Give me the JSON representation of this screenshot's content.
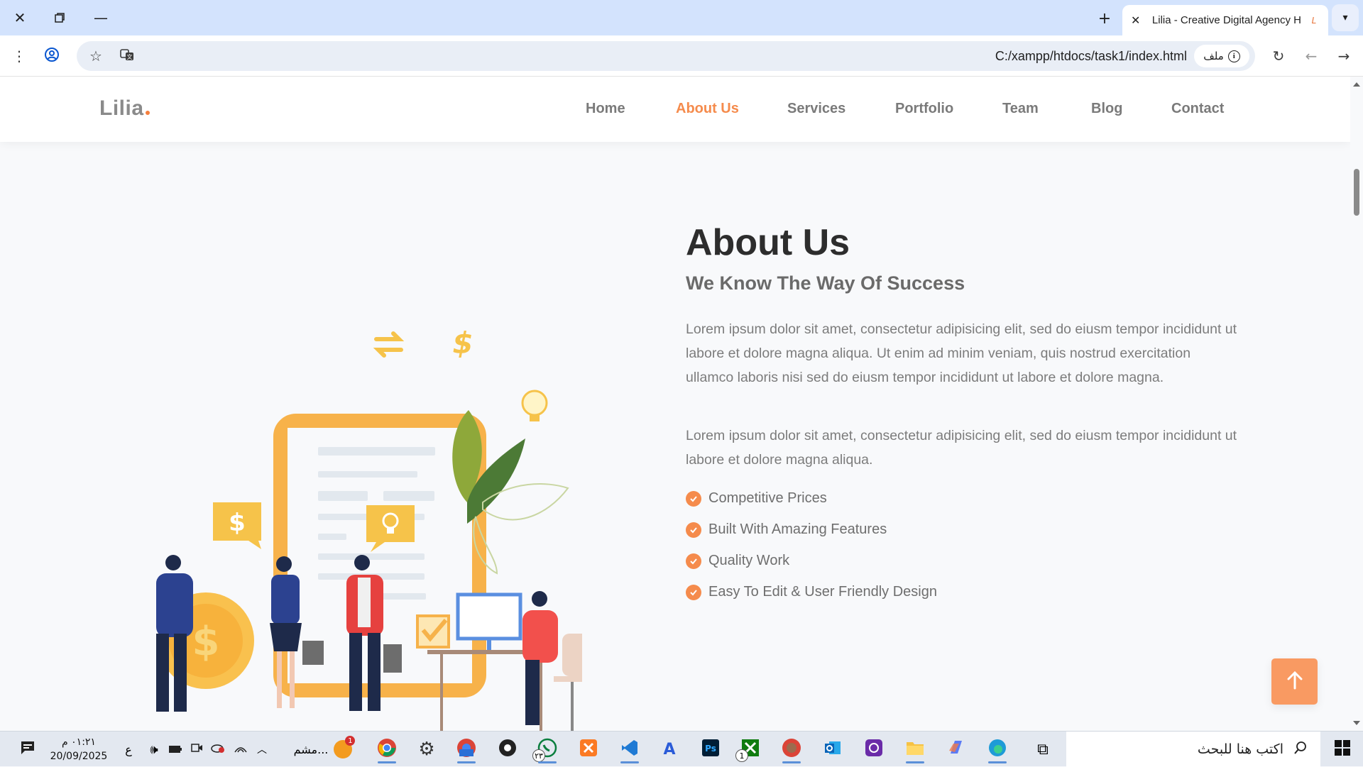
{
  "browser": {
    "tab_title": "Lilia - Creative Digital Agency H",
    "url": "C:/xampp/htdocs/task1/index.html",
    "file_chip_label": "ملف",
    "icons": [
      "close-icon",
      "restore-icon",
      "minimize-icon",
      "plus-icon",
      "chevron-down-icon",
      "menu-dots-icon",
      "profile-icon",
      "star-icon",
      "translate-icon",
      "info-icon",
      "reload-icon",
      "back-icon",
      "forward-icon"
    ]
  },
  "site": {
    "logo": "Lilia",
    "nav": [
      {
        "label": "Home",
        "active": false
      },
      {
        "label": "About Us",
        "active": true
      },
      {
        "label": "Services",
        "active": false
      },
      {
        "label": "Portfolio",
        "active": false
      },
      {
        "label": "Team",
        "active": false
      },
      {
        "label": "Blog",
        "active": false
      },
      {
        "label": "Contact",
        "active": false
      }
    ],
    "about": {
      "title": "About Us",
      "subtitle": "We Know The Way Of Success",
      "paragraph1": "Lorem ipsum dolor sit amet, consectetur adipisicing elit, sed do eiusm tempor incididunt ut labore et dolore magna aliqua. Ut enim ad minim veniam, quis nostrud exercitation ullamco laboris nisi sed do eiusm tempor incididunt ut labore et dolore magna.",
      "paragraph2": "Lorem ipsum dolor sit amet, consectetur adipisicing elit, sed do eiusm tempor incididunt ut labore et dolore magna aliqua.",
      "features": [
        "Competitive Prices",
        "Built With Amazing Features",
        "Quality Work",
        "Easy To Edit & User Friendly Design"
      ]
    },
    "colors": {
      "accent": "#f58b4c",
      "heading": "#2d2d2d",
      "text": "#7c7c7c"
    }
  },
  "taskbar": {
    "search_placeholder": "اكتب هنا للبحث",
    "time": "٠١:٢١ م",
    "date": "20/09/2025",
    "language": "ع",
    "notification_label": "مشم...",
    "notification_badge": "1",
    "whatsapp_badge": "٢٣",
    "xbox_badge": "1"
  }
}
